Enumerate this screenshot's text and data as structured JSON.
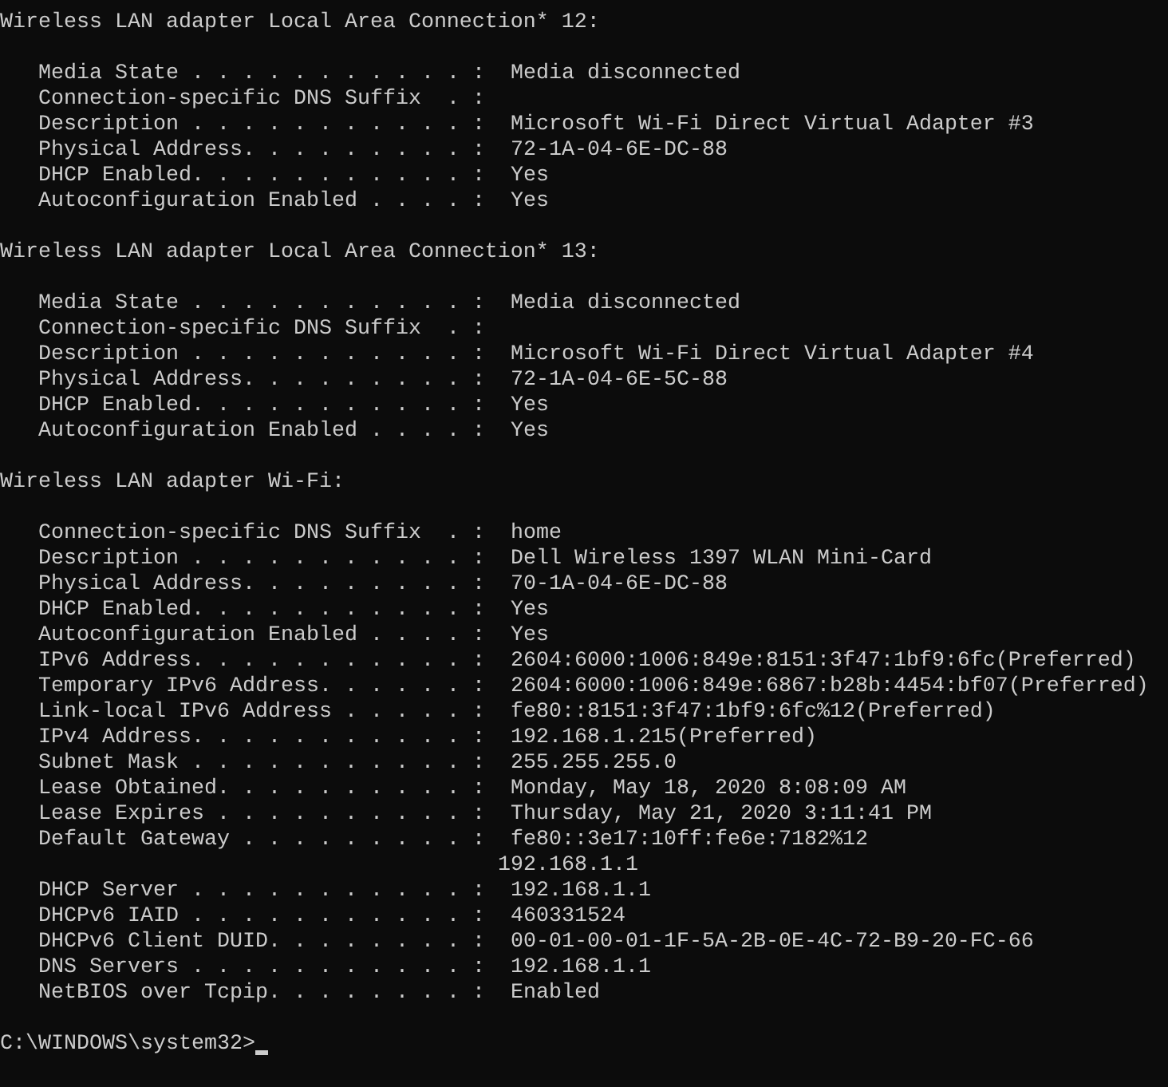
{
  "sections": [
    {
      "heading": "Wireless LAN adapter Local Area Connection* 12:",
      "properties": [
        {
          "label": "Media State . . . . . . . . . . . :",
          "value": "Media disconnected"
        },
        {
          "label": "Connection-specific DNS Suffix  . :"
        },
        {
          "label": "Description . . . . . . . . . . . :",
          "value": "Microsoft Wi-Fi Direct Virtual Adapter #3"
        },
        {
          "label": "Physical Address. . . . . . . . . :",
          "value": "72-1A-04-6E-DC-88"
        },
        {
          "label": "DHCP Enabled. . . . . . . . . . . :",
          "value": "Yes"
        },
        {
          "label": "Autoconfiguration Enabled . . . . :",
          "value": "Yes"
        }
      ]
    },
    {
      "heading": "Wireless LAN adapter Local Area Connection* 13:",
      "properties": [
        {
          "label": "Media State . . . . . . . . . . . :",
          "value": "Media disconnected"
        },
        {
          "label": "Connection-specific DNS Suffix  . :"
        },
        {
          "label": "Description . . . . . . . . . . . :",
          "value": "Microsoft Wi-Fi Direct Virtual Adapter #4"
        },
        {
          "label": "Physical Address. . . . . . . . . :",
          "value": "72-1A-04-6E-5C-88"
        },
        {
          "label": "DHCP Enabled. . . . . . . . . . . :",
          "value": "Yes"
        },
        {
          "label": "Autoconfiguration Enabled . . . . :",
          "value": "Yes"
        }
      ]
    },
    {
      "heading": "Wireless LAN adapter Wi-Fi:",
      "properties": [
        {
          "label": "Connection-specific DNS Suffix  . :",
          "value": "home"
        },
        {
          "label": "Description . . . . . . . . . . . :",
          "value": "Dell Wireless 1397 WLAN Mini-Card"
        },
        {
          "label": "Physical Address. . . . . . . . . :",
          "value": "70-1A-04-6E-DC-88"
        },
        {
          "label": "DHCP Enabled. . . . . . . . . . . :",
          "value": "Yes"
        },
        {
          "label": "Autoconfiguration Enabled . . . . :",
          "value": "Yes"
        },
        {
          "label": "IPv6 Address. . . . . . . . . . . :",
          "value": "2604:6000:1006:849e:8151:3f47:1bf9:6fc(Preferred)"
        },
        {
          "label": "Temporary IPv6 Address. . . . . . :",
          "value": "2604:6000:1006:849e:6867:b28b:4454:bf07(Preferred)"
        },
        {
          "label": "Link-local IPv6 Address . . . . . :",
          "value": "fe80::8151:3f47:1bf9:6fc%12(Preferred)"
        },
        {
          "label": "IPv4 Address. . . . . . . . . . . :",
          "value": "192.168.1.215(Preferred)"
        },
        {
          "label": "Subnet Mask . . . . . . . . . . . :",
          "value": "255.255.255.0"
        },
        {
          "label": "Lease Obtained. . . . . . . . . . :",
          "value": "Monday, May 18, 2020 8:08:09 AM"
        },
        {
          "label": "Lease Expires . . . . . . . . . . :",
          "value": "Thursday, May 21, 2020 3:11:41 PM"
        },
        {
          "label": "Default Gateway . . . . . . . . . :",
          "value": "fe80::3e17:10ff:fe6e:7182%12",
          "extra_values": [
            "192.168.1.1"
          ]
        },
        {
          "label": "DHCP Server . . . . . . . . . . . :",
          "value": "192.168.1.1"
        },
        {
          "label": "DHCPv6 IAID . . . . . . . . . . . :",
          "value": "460331524"
        },
        {
          "label": "DHCPv6 Client DUID. . . . . . . . :",
          "value": "00-01-00-01-1F-5A-2B-0E-4C-72-B9-20-FC-66"
        },
        {
          "label": "DNS Servers . . . . . . . . . . . :",
          "value": "192.168.1.1"
        },
        {
          "label": "NetBIOS over Tcpip. . . . . . . . :",
          "value": "Enabled"
        }
      ]
    }
  ],
  "prompt": "C:\\WINDOWS\\system32>"
}
